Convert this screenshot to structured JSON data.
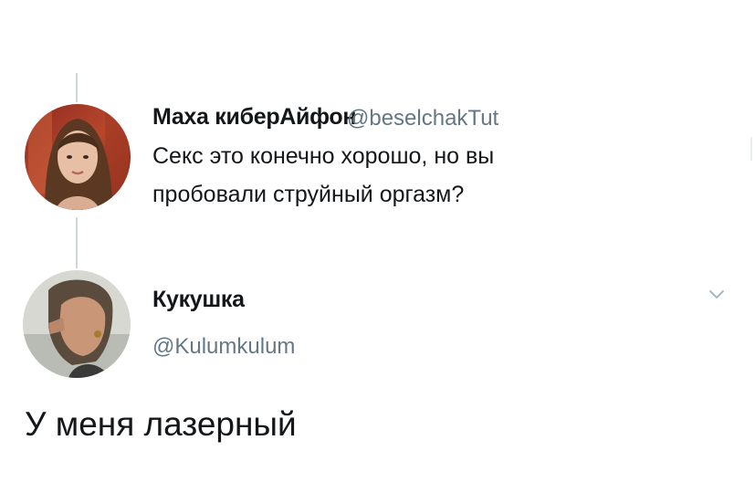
{
  "tweet": {
    "author_name": "Маха киберАйфон",
    "author_handle": "@beselchakTut",
    "text_line1": "Секс это конечно хорошо, но вы",
    "text_line2": "пробовали струйный оргазм?"
  },
  "reply": {
    "author_name": "Кукушка",
    "author_handle": "@Kulumkulum",
    "text": "У меня лазерный",
    "menu_icon": "chevron-down-icon"
  },
  "colors": {
    "text": "#14171a",
    "secondary_text": "#657786",
    "thread_line": "#ccd6dd",
    "chevron": "#aab8c2"
  }
}
